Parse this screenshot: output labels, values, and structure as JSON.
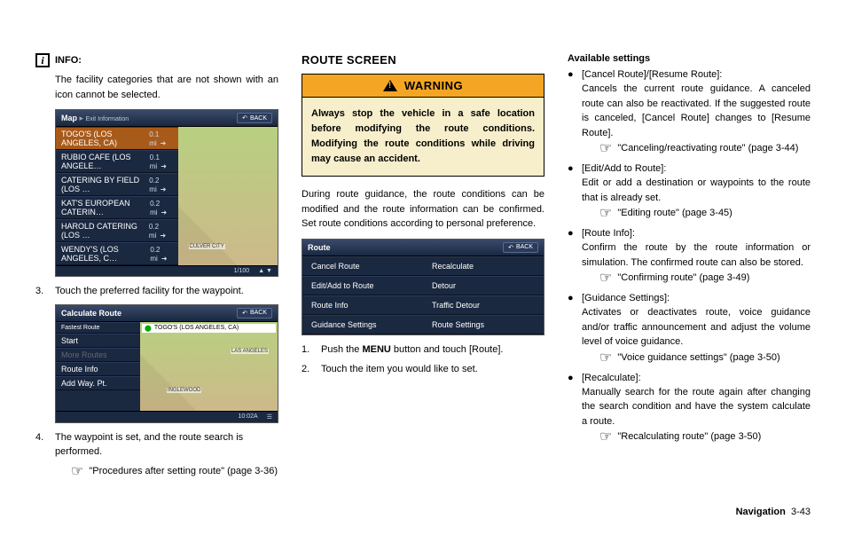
{
  "col1": {
    "info_label": "INFO:",
    "info_text": "The facility categories that are not shown with an icon cannot be selected.",
    "screenshot1": {
      "title_main": "Map",
      "title_sub": "Exit Information",
      "back": "BACK",
      "rows": [
        {
          "name": "TOGO'S (LOS ANGELES, CA)",
          "dist": "0.1 mi"
        },
        {
          "name": "RUBIO CAFE (LOS ANGELE…",
          "dist": "0.1 mi"
        },
        {
          "name": "CATERING BY FIELD (LOS …",
          "dist": "0.2 mi"
        },
        {
          "name": "KAT'S EUROPEAN CATERIN…",
          "dist": "0.2 mi"
        },
        {
          "name": "HAROLD CATERING (LOS …",
          "dist": "0.2 mi"
        },
        {
          "name": "WENDY'S (LOS ANGELES, C…",
          "dist": "0.2 mi"
        }
      ],
      "map_label": "CULVER CITY",
      "foot_left": "1/100",
      "foot_right": ""
    },
    "step3": "Touch the preferred facility for the waypoint.",
    "screenshot2": {
      "title": "Calculate Route",
      "back": "BACK",
      "dest": "TOGO'S (LOS ANGELES, CA)",
      "side": [
        "Fastest Route",
        "Start",
        "More Routes",
        "Route Info",
        "Add Way. Pt."
      ],
      "map_label1": "LAS ANGELES",
      "map_label2": "INGLEWOOD",
      "foot": "10:02A"
    },
    "step4": "The waypoint is set, and the route search is performed.",
    "ref1_text": "\"Procedures after setting route\" (page 3-36)"
  },
  "col2": {
    "heading": "Route Screen",
    "warn_label": "WARNING",
    "warn_body": "Always stop the vehicle in a safe location before modifying the route conditions. Modifying the route conditions while driving may cause an accident.",
    "para": "During route guidance, the route conditions can be modified and the route information can be confirmed. Set route conditions according to personal preference.",
    "screenshot3": {
      "title": "Route",
      "back": "BACK",
      "left": [
        "Cancel Route",
        "Edit/Add to Route",
        "Route Info",
        "Guidance Settings"
      ],
      "right": [
        "Recalculate",
        "Detour",
        "Traffic Detour",
        "Route Settings"
      ]
    },
    "step1_pre": "Push the ",
    "step1_bold": "MENU",
    "step1_post": " button and touch [Route].",
    "step2": "Touch the item you would like to set."
  },
  "col3": {
    "heading": "Available settings",
    "items": [
      {
        "name": "[Cancel Route]/[Resume Route]:",
        "desc": "Cancels the current route guidance. A canceled route can also be reactivated. If the suggested route is canceled, [Cancel Route] changes to [Resume Route].",
        "ref": "\"Canceling/reactivating route\" (page 3-44)"
      },
      {
        "name": "[Edit/Add to Route]:",
        "desc": "Edit or add a destination or waypoints to the route that is already set.",
        "ref": "\"Editing route\" (page 3-45)"
      },
      {
        "name": "[Route Info]:",
        "desc": "Confirm the route by the route information or simulation. The confirmed route can also be stored.",
        "ref": "\"Confirming route\" (page 3-49)"
      },
      {
        "name": "[Guidance Settings]:",
        "desc": "Activates or deactivates route, voice guidance and/or traffic announcement and adjust the volume level of voice guidance.",
        "ref": "\"Voice guidance settings\" (page 3-50)"
      },
      {
        "name": "[Recalculate]:",
        "desc": "Manually search for the route again after changing the search condition and have the system calculate a route.",
        "ref": "\"Recalculating route\" (page 3-50)"
      }
    ]
  },
  "footer": {
    "section": "Navigation",
    "page": "3-43"
  }
}
